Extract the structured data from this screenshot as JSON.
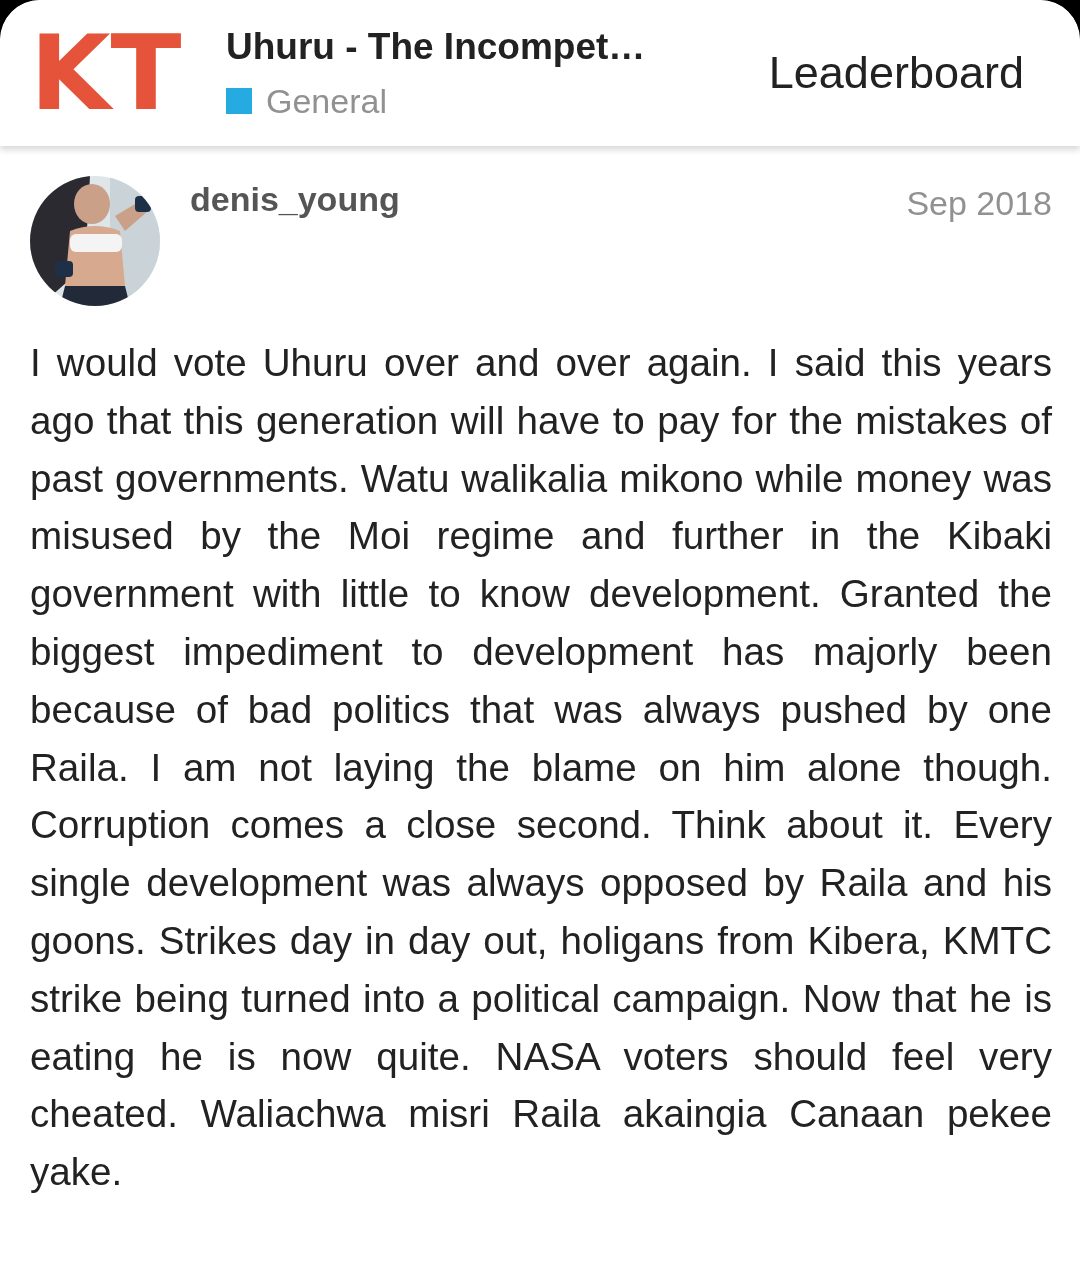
{
  "header": {
    "logo": "KT",
    "title": "Uhuru - The Incompet…",
    "category": {
      "name": "General",
      "color": "#25aae1"
    },
    "nav_link": "Leaderboard"
  },
  "post": {
    "author": "denis_young",
    "date": "Sep 2018",
    "paragraphs": [
      "I would vote Uhuru over and over again. I said this years ago that this generation will have to pay for the mistakes of past governments. Watu walikalia mikono while money was misused by the Moi regime and further in the Kibaki government with little to know development. Granted the biggest impediment to development has majorly been because of bad politics that was always pushed by one Raila. I am not laying the blame on him alone though. Corruption comes a close second. Think about it. Every single development was always opposed by Raila and his goons. Strikes day in day out, holigans from Kibera, KMTC strike being turned into a political campaign. Now that he is eating he is now quite. NASA voters should feel very cheated. Waliachwa misri Raila akaingia Canaan pekee yake."
    ]
  }
}
